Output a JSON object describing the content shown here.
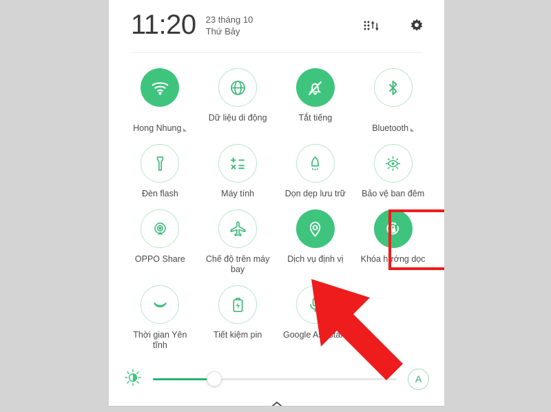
{
  "header": {
    "time": "11:20",
    "date": "23 tháng 10",
    "weekday": "Thứ Bảy",
    "data_usage_icon": "data-transfer-icon",
    "settings_icon": "gear-icon"
  },
  "toggles": {
    "rows": [
      [
        {
          "label": "Hong Nhung",
          "icon": "wifi-icon",
          "active": true,
          "has_caret": true
        },
        {
          "label": "Dữ liệu di động",
          "icon": "globe-icon",
          "active": false,
          "has_caret": false
        },
        {
          "label": "Tắt tiếng",
          "icon": "bell-off-icon",
          "active": true,
          "has_caret": false
        },
        {
          "label": "Bluetooth",
          "icon": "bluetooth-icon",
          "active": false,
          "has_caret": true
        }
      ],
      [
        {
          "label": "Đèn flash",
          "icon": "flashlight-icon",
          "active": false,
          "has_caret": false
        },
        {
          "label": "Máy tính",
          "icon": "calculator-icon",
          "active": false,
          "has_caret": false
        },
        {
          "label": "Dọn dẹp lưu trữ",
          "icon": "storage-cleanup-icon",
          "active": false,
          "has_caret": false
        },
        {
          "label": "Bảo vệ ban đêm",
          "icon": "night-shield-eye-icon",
          "active": false,
          "has_caret": false
        }
      ],
      [
        {
          "label": "OPPO Share",
          "icon": "oppo-share-icon",
          "active": false,
          "has_caret": false
        },
        {
          "label": "Chế độ trên máy\nbay",
          "icon": "airplane-icon",
          "active": false,
          "has_caret": false
        },
        {
          "label": "Dịch vụ định vị",
          "icon": "location-pin-icon",
          "active": true,
          "has_caret": false,
          "highlighted": true
        },
        {
          "label": "Khóa hướng dọc",
          "icon": "rotation-lock-icon",
          "active": true,
          "has_caret": false
        }
      ],
      [
        {
          "label": "Thời gian Yên\ntĩnh",
          "icon": "moon-icon",
          "active": false,
          "has_caret": false
        },
        {
          "label": "Tiết kiệm pin",
          "icon": "battery-saver-icon",
          "active": false,
          "has_caret": false
        },
        {
          "label": "Google Assistant",
          "icon": "microphone-icon",
          "active": false,
          "has_caret": false
        }
      ]
    ]
  },
  "brightness": {
    "sun_icon": "brightness-icon",
    "value_percent": 25,
    "auto_label": "A"
  },
  "footer": {
    "expand_icon": "chevron-up-icon"
  },
  "annotation": {
    "highlight_color": "#ee1c1c",
    "arrow_color": "#ee1c1c",
    "target": "Dịch vụ định vị"
  },
  "colors": {
    "accent_green": "#3fc47e",
    "outline_green": "#b9e4cd",
    "backdrop_gray": "#d4d4d4",
    "panel_white": "#ffffff"
  }
}
